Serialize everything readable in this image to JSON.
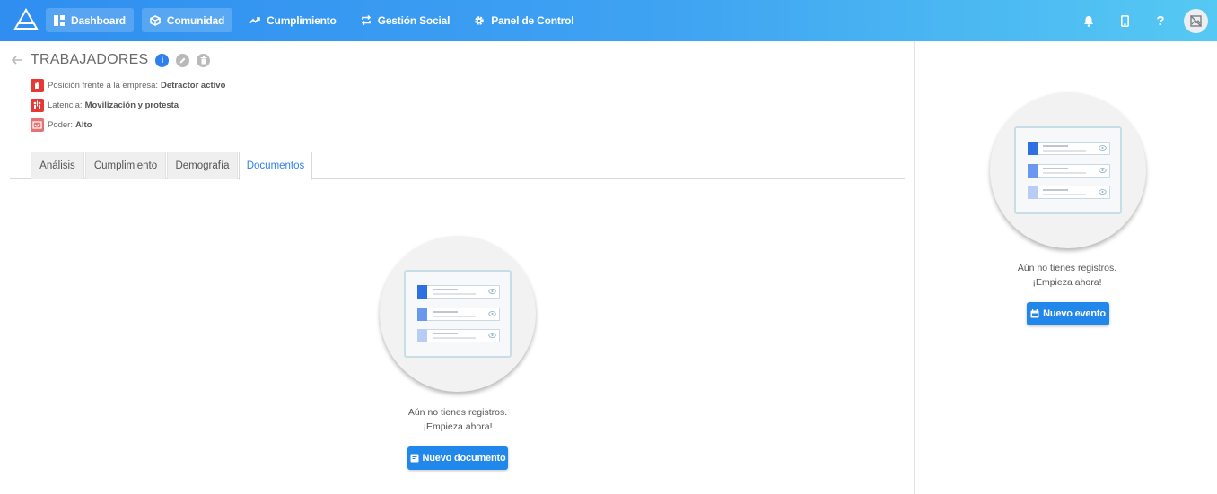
{
  "nav": {
    "items": [
      {
        "label": "Dashboard",
        "icon": "dashboard-icon",
        "active": true
      },
      {
        "label": "Comunidad",
        "icon": "cube-icon",
        "active": true
      },
      {
        "label": "Cumplimiento",
        "icon": "trend-icon",
        "active": false
      },
      {
        "label": "Gestión Social",
        "icon": "repeat-icon",
        "active": false
      },
      {
        "label": "Panel de Control",
        "icon": "gear-icon",
        "active": false
      }
    ],
    "help": "?"
  },
  "header": {
    "title": "TRABAJADORES",
    "info": "i"
  },
  "attributes": [
    {
      "label": "Posición frente a la empresa:",
      "value": "Detractor activo",
      "color": "#e53935"
    },
    {
      "label": "Latencia:",
      "value": "Movilización y protesta",
      "color": "#e53935"
    },
    {
      "label": "Poder:",
      "value": "Alto",
      "color": "#e57373"
    }
  ],
  "tabs": [
    "Análisis",
    "Cumplimiento",
    "Demografía",
    "Documentos"
  ],
  "active_tab": "Documentos",
  "main_empty": {
    "line1": "Aún no tienes registros.",
    "line2": "¡Empieza ahora!",
    "button": "Nuevo documento"
  },
  "side_empty": {
    "line1": "Aún no tienes registros.",
    "line2": "¡Empieza ahora!",
    "button": "Nuevo evento"
  },
  "colors": {
    "accent": "#2187ea",
    "nav_start": "#2f8ef0",
    "nav_end": "#55c9f3"
  }
}
